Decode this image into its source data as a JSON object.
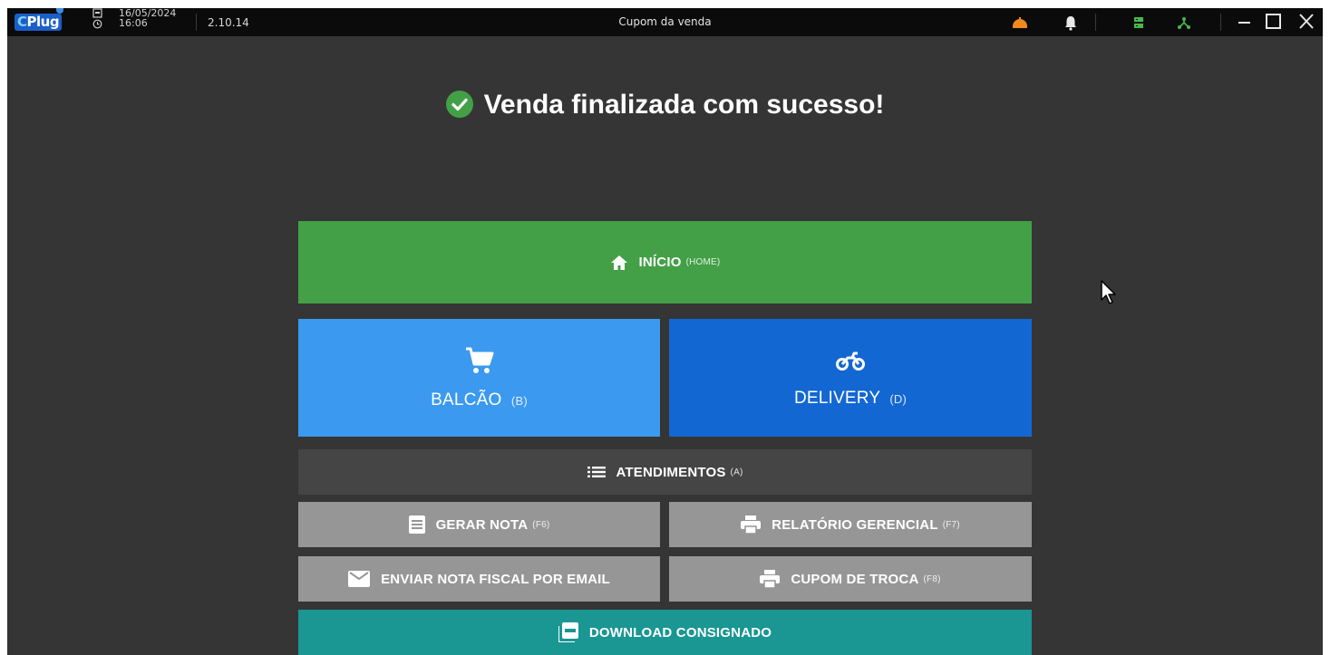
{
  "titlebar": {
    "logo": "CPlug",
    "date": "16/05/2024",
    "time": "16:06",
    "version": "2.10.14",
    "title": "Cupom da venda",
    "icons": [
      "notification-bell-orange-icon",
      "bell-icon",
      "server-status-icon",
      "network-icon"
    ],
    "window_controls": [
      "minimize-icon",
      "maximize-icon",
      "close-icon"
    ]
  },
  "headline": {
    "icon": "check-circle-icon",
    "text": "Venda finalizada com sucesso!"
  },
  "actions": {
    "inicio": {
      "label": "INÍCIO",
      "key": "(HOME)",
      "icon": "home-icon",
      "color": "#43a047"
    },
    "balcao": {
      "label": "BALCÃO",
      "key": "(B)",
      "icon": "cart-icon",
      "color": "#3b99ef"
    },
    "delivery": {
      "label": "DELIVERY",
      "key": "(D)",
      "icon": "motorcycle-icon",
      "color": "#1367d2"
    },
    "atendimentos": {
      "label": "ATENDIMENTOS",
      "key": "(A)",
      "icon": "list-icon",
      "color": "#454545"
    },
    "gerar_nota": {
      "label": "GERAR NOTA",
      "key": "(F6)",
      "icon": "document-icon",
      "color": "#969696"
    },
    "relatorio": {
      "label": "RELATÓRIO GERENCIAL",
      "key": "(F7)",
      "icon": "printer-icon",
      "color": "#969696"
    },
    "enviar_email": {
      "label": "ENVIAR NOTA FISCAL POR EMAIL",
      "key": "",
      "icon": "email-icon",
      "color": "#969696"
    },
    "cupom_troca": {
      "label": "CUPOM DE TROCA",
      "key": "(F8)",
      "icon": "printer-icon",
      "color": "#969696"
    },
    "download": {
      "label": "DOWNLOAD CONSIGNADO",
      "key": "",
      "icon": "pdf-icon",
      "color": "#1a9693"
    }
  }
}
